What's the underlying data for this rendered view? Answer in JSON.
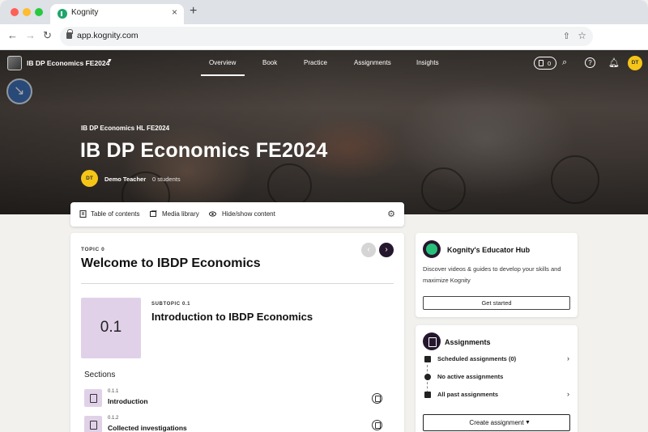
{
  "browser": {
    "tab_title": "Kognity",
    "tab_close": "×",
    "new_tab": "+",
    "url": "app.kognity.com"
  },
  "topnav": {
    "course_name": "IB DP Economics FE2024",
    "items": [
      "Overview",
      "Book",
      "Practice",
      "Assignments",
      "Insights"
    ],
    "active_item": "Overview",
    "counter": "0",
    "avatar_initials": "DT"
  },
  "hero": {
    "subtitle": "IB DP Economics HL FE2024",
    "title": "IB DP Economics FE2024",
    "teacher_initials": "DT",
    "teacher_name": "Demo Teacher",
    "student_count": "0 students"
  },
  "tocbar": {
    "table_of_contents": "Table of contents",
    "media_library": "Media library",
    "hide_show": "Hide/show content"
  },
  "topic": {
    "label": "TOPIC 0",
    "title": "Welcome to IBDP Economics",
    "subtopic_number": "0.1",
    "subtopic_label": "SUBTOPIC 0.1",
    "subtopic_title": "Introduction to IBDP Economics",
    "sections_heading": "Sections",
    "sections": [
      {
        "num": "0.1.1",
        "title": "Introduction"
      },
      {
        "num": "0.1.2",
        "title": "Collected investigations"
      }
    ]
  },
  "hub": {
    "title": "Kognity's Educator Hub",
    "description": "Discover videos & guides to develop your skills and maximize Kognity",
    "button": "Get started"
  },
  "assignments": {
    "title": "Assignments",
    "rows": [
      {
        "label": "Scheduled assignments (0)",
        "chevron": true
      },
      {
        "label": "No active assignments",
        "chevron": false
      },
      {
        "label": "All past assignments",
        "chevron": true
      }
    ],
    "create_button": "Create assignment"
  },
  "colors": {
    "accent_dark": "#25172e",
    "subtopic_tile": "#e1d1e8",
    "avatar": "#f5c518",
    "hub_green": "#27c07a"
  }
}
